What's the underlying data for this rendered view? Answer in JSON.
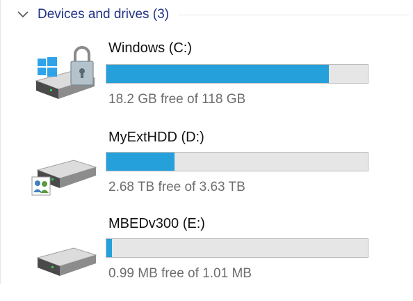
{
  "group": {
    "title": "Devices and drives (3)",
    "expanded": true
  },
  "colors": {
    "group_title": "#1e3287",
    "bar_fill": "#26a0da",
    "bar_track": "#e6e6e6",
    "free_text": "#6d6d6d"
  },
  "drives": [
    {
      "name": "Windows (C:)",
      "free_text": "18.2 GB free of 118 GB",
      "used_fraction": 0.85,
      "icon": "windows-drive-locked-icon"
    },
    {
      "name": "MyExtHDD (D:)",
      "free_text": "2.68 TB free of 3.63 TB",
      "used_fraction": 0.26,
      "icon": "shared-hard-drive-icon"
    },
    {
      "name": "MBEDv300 (E:)",
      "free_text": "0.99 MB free of 1.01 MB",
      "used_fraction": 0.02,
      "icon": "hard-drive-icon"
    }
  ]
}
